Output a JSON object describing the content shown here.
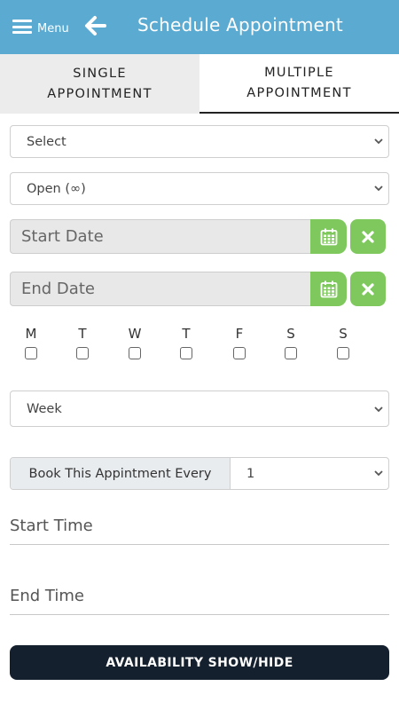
{
  "header": {
    "menu_label": "Menu",
    "title": "Schedule Appointment",
    "background": "#5aaad1"
  },
  "tabs": [
    {
      "line1": "SINGLE",
      "line2": "APPOINTMENT",
      "active": false
    },
    {
      "line1": "MULTIPLE",
      "line2": "APPOINTMENT",
      "active": true
    }
  ],
  "form": {
    "select_value": "Select",
    "open_value": "Open (∞)",
    "start_date_placeholder": "Start Date",
    "end_date_placeholder": "End Date",
    "days": [
      "M",
      "T",
      "W",
      "T",
      "F",
      "S",
      "S"
    ],
    "period_value": "Week",
    "book_label": "Book This Appintment Every",
    "book_value": "1",
    "start_time_placeholder": "Start Time",
    "end_time_placeholder": "End Time",
    "availability_button": "AVAILABILITY SHOW/HIDE"
  },
  "colors": {
    "accent_green": "#7ec85d",
    "button_dark": "#14202e"
  },
  "icons": {
    "menu": "hamburger-icon",
    "back": "arrow-left-icon",
    "calendar": "calendar-icon",
    "clear": "x-icon",
    "dropdown": "chevron-down-icon"
  }
}
